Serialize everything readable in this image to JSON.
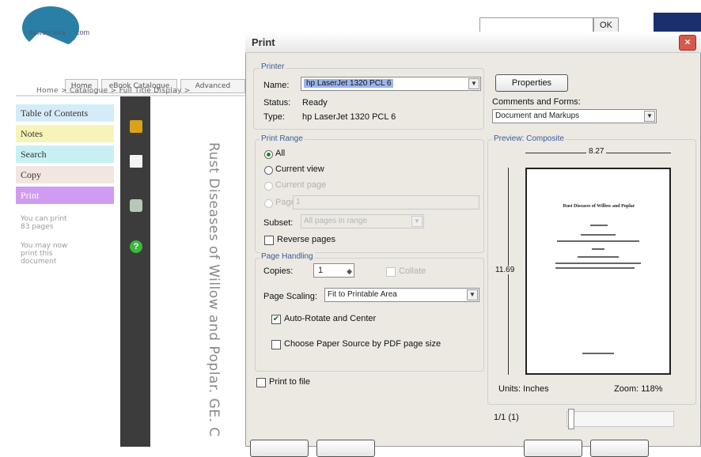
{
  "site": {
    "logo_text_left": "dawsonera",
    "logo_text_right": "com",
    "search_ok": "OK",
    "nav": [
      "Home",
      "eBook Catalogue",
      "Advanced"
    ],
    "breadcrumb": "Home > Catalogue > Full Title Display >",
    "sidebar": {
      "items": [
        {
          "label": "Table of Contents",
          "color": "#d6ebf8"
        },
        {
          "label": "Notes",
          "color": "#f8f4b8"
        },
        {
          "label": "Search",
          "color": "#c8f0f4"
        },
        {
          "label": "Copy",
          "color": "#f1e6e0"
        },
        {
          "label": "Print",
          "color": "#cf9cf2"
        }
      ],
      "note_print": "You can print 83 pages",
      "note_view": "You may now print this document"
    },
    "doc_vertical_title": "Rust Diseases of Willow and Poplar. GE. C"
  },
  "dialog": {
    "title": "Print",
    "close": "×",
    "printer": {
      "group_label": "Printer",
      "name_label": "Name:",
      "name_value": "hp LaserJet 1320 PCL 6",
      "status_label": "Status:",
      "status_value": "Ready",
      "type_label": "Type:",
      "type_value": "hp LaserJet 1320 PCL 6",
      "properties_button": "Properties",
      "comments_label": "Comments and Forms:",
      "comments_value": "Document and Markups"
    },
    "print_range": {
      "group_label": "Print Range",
      "all": "All",
      "current_view": "Current view",
      "current_page": "Current page",
      "pages": "Pages",
      "pages_value": "1",
      "subset_label": "Subset:",
      "subset_value": "All pages in range",
      "reverse_pages": "Reverse pages"
    },
    "page_handling": {
      "group_label": "Page Handling",
      "copies_label": "Copies:",
      "copies_value": "1",
      "collate": "Collate",
      "scaling_label": "Page Scaling:",
      "scaling_value": "Fit to Printable Area",
      "auto_rotate": "Auto-Rotate and Center",
      "auto_rotate_checked": true,
      "choose_paper": "Choose Paper Source by PDF page size"
    },
    "print_to_file": "Print to file",
    "preview": {
      "group_label": "Preview: Composite",
      "width": "8.27",
      "height": "11.69",
      "units": "Units: Inches",
      "zoom": "Zoom: 118%",
      "page_counter": "1/1 (1)",
      "page_title": "Rust Diseases of Willow and Poplar"
    }
  }
}
